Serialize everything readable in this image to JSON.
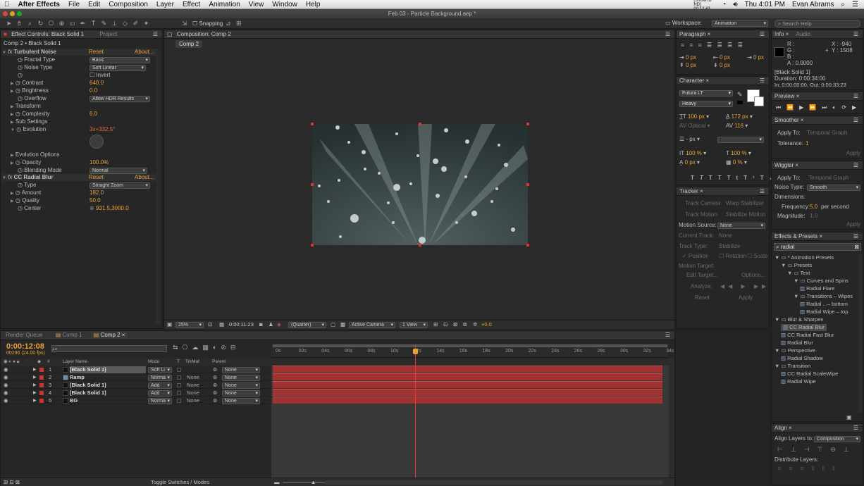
{
  "menubar": {
    "apple": "",
    "app": "After Effects",
    "items": [
      "File",
      "Edit",
      "Composition",
      "Layer",
      "Effect",
      "Animation",
      "View",
      "Window",
      "Help"
    ],
    "status_showhd": "[ShowHD HD] 00:12:43",
    "clock": "Thu 4:01 PM",
    "user": "Evan Abrams"
  },
  "window": {
    "title": "Feb 03 - Particle Background.aep *"
  },
  "toolbar": {
    "snapping": "Snapping",
    "workspace_label": "Workspace:",
    "workspace_value": "Animation",
    "search_placeholder": "Search Help"
  },
  "effect_controls": {
    "tab": "Effect Controls: Black Solid 1",
    "project_tab": "Project",
    "breadcrumb": "Comp 2 • Black Solid 1",
    "turbulent": {
      "name": "Turbulent Noise",
      "reset": "Reset",
      "about": "About...",
      "fractal_type_label": "Fractal Type",
      "fractal_type": "Basic",
      "noise_type_label": "Noise Type",
      "noise_type": "Soft Linear",
      "invert_label": "Invert",
      "contrast_label": "Contrast",
      "contrast": "640.0",
      "brightness_label": "Brightness",
      "brightness": "0.0",
      "overflow_label": "Overflow",
      "overflow": "Allow HDR Results",
      "transform_label": "Transform",
      "complexity_label": "Complexity",
      "complexity": "6.0",
      "sub_settings_label": "Sub Settings",
      "evolution_label": "Evolution",
      "evolution": "3x+332.5°",
      "evolution_options_label": "Evolution Options",
      "opacity_label": "Opacity",
      "opacity": "100.0%",
      "blending_label": "Blending Mode",
      "blending": "Normal"
    },
    "radial": {
      "name": "CC Radial Blur",
      "reset": "Reset",
      "about": "About...",
      "type_label": "Type",
      "type": "Straight Zoom",
      "amount_label": "Amount",
      "amount": "182.0",
      "quality_label": "Quality",
      "quality": "50.0",
      "center_label": "Center",
      "center": "931.5,3000.0"
    }
  },
  "composition": {
    "tab": "Composition: Comp 2",
    "subtab": "Comp 2",
    "zoom": "25%",
    "timecode": "0:00:11:23",
    "resolution": "(Quarter)",
    "camera": "Active Camera",
    "views": "1 View",
    "exposure": "+0.0",
    "bg_color": "#2f3b3b"
  },
  "paragraph": {
    "tab": "Paragraph",
    "v1": "0 px",
    "v2": "0 px",
    "v3": "0 px",
    "v4": "0 px",
    "v5": "0 px"
  },
  "character": {
    "tab": "Character",
    "font": "Futura LT",
    "style": "Heavy",
    "size": "100 px",
    "leading": "172 px",
    "kerning": "Optical",
    "tracking": "116",
    "stroke": "- px",
    "vscale": "100 %",
    "hscale": "100 %",
    "baseline": "0 px",
    "tsume": "0 %"
  },
  "tracker": {
    "tab": "Tracker",
    "track_camera": "Track Camera",
    "warp": "Warp Stabilizer",
    "track_motion": "Track Motion",
    "stabilize": "Stabilize Motion",
    "motion_source_label": "Motion Source:",
    "motion_source": "None",
    "current_track_label": "Current Track:",
    "current_track": "None",
    "track_type_label": "Track Type:",
    "track_type": "Stabilize",
    "position": "Position",
    "rotation": "Rotation",
    "scale": "Scale",
    "motion_target": "Motion Target:",
    "edit_target": "Edit Target...",
    "options": "Options...",
    "analyze": "Analyze:",
    "reset": "Reset",
    "apply": "Apply"
  },
  "info": {
    "tab": "Info",
    "audio_tab": "Audio",
    "r": "R :",
    "g": "G :",
    "b": "B :",
    "a": "A : 0.0000",
    "x": "X : -940",
    "y": "Y : 1508",
    "layer": "[Black Solid 1]",
    "duration": "Duration: 0:00:34:00",
    "inout": "In: 0:00:00:00, Out: 0:00:33:23"
  },
  "preview": {
    "tab": "Preview"
  },
  "smoother": {
    "tab": "Smoother",
    "apply_to_label": "Apply To:",
    "apply_to": "Temporal Graph",
    "tolerance_label": "Tolerance:",
    "tolerance": "1",
    "apply": "Apply"
  },
  "wiggler": {
    "tab": "Wiggler",
    "apply_to_label": "Apply To:",
    "apply_to": "Temporal Graph",
    "noise_label": "Noise Type:",
    "noise": "Smooth",
    "dimensions_label": "Dimensions:",
    "frequency_label": "Frequency:",
    "frequency": "5.0",
    "per_second": "per second",
    "magnitude_label": "Magnitude:",
    "magnitude": "1.0",
    "apply": "Apply"
  },
  "effects_presets": {
    "tab": "Effects & Presets",
    "search": "radial",
    "tree": [
      {
        "label": "* Animation Presets",
        "indent": 0,
        "type": "folder"
      },
      {
        "label": "Presets",
        "indent": 1,
        "type": "folder"
      },
      {
        "label": "Text",
        "indent": 2,
        "type": "folder"
      },
      {
        "label": "Curves and Spins",
        "indent": 3,
        "type": "folder"
      },
      {
        "label": "Radial Flare",
        "indent": 4,
        "type": "item"
      },
      {
        "label": "Transitions – Wipes",
        "indent": 3,
        "type": "folder"
      },
      {
        "label": "Radial ...– bottom",
        "indent": 4,
        "type": "item"
      },
      {
        "label": "Radial Wipe – top",
        "indent": 4,
        "type": "item"
      },
      {
        "label": "Blur & Sharpen",
        "indent": 0,
        "type": "folder"
      },
      {
        "label": "CC Radial Blur",
        "indent": 1,
        "type": "item",
        "selected": true
      },
      {
        "label": "CC Radial Fast Blur",
        "indent": 1,
        "type": "item"
      },
      {
        "label": "Radial Blur",
        "indent": 1,
        "type": "item"
      },
      {
        "label": "Perspective",
        "indent": 0,
        "type": "folder"
      },
      {
        "label": "Radial Shadow",
        "indent": 1,
        "type": "item"
      },
      {
        "label": "Transition",
        "indent": 0,
        "type": "folder"
      },
      {
        "label": "CC Radial ScaleWipe",
        "indent": 1,
        "type": "item"
      },
      {
        "label": "Radial Wipe",
        "indent": 1,
        "type": "item"
      }
    ]
  },
  "align": {
    "tab": "Align",
    "align_to_label": "Align Layers to:",
    "align_to": "Composition",
    "distribute": "Distribute Layers:"
  },
  "timeline": {
    "tabs": [
      "Render Queue",
      "Comp 1",
      "Comp 2"
    ],
    "timecode": "0:00:12:08",
    "frames": "00296 (24.00 fps)",
    "cols": {
      "num": "#",
      "name": "Layer Name",
      "mode": "Mode",
      "t": "T",
      "trkmat": "TrkMat",
      "parent": "Parent"
    },
    "ruler": [
      "0s",
      "02s",
      "04s",
      "06s",
      "08s",
      "10s",
      "12s",
      "14s",
      "16s",
      "18s",
      "20s",
      "22s",
      "24s",
      "26s",
      "28s",
      "30s",
      "32s",
      "34s"
    ],
    "layers": [
      {
        "num": "1",
        "name": "[Black Solid 1]",
        "mode": "Soft Li",
        "trkmat": "",
        "parent": "None",
        "selected": true
      },
      {
        "num": "2",
        "name": "Ramp",
        "mode": "Norma",
        "trkmat": "None",
        "parent": "None"
      },
      {
        "num": "3",
        "name": "[Black Solid 1]",
        "mode": "Add",
        "trkmat": "None",
        "parent": "None"
      },
      {
        "num": "4",
        "name": "[Black Solid 1]",
        "mode": "Add",
        "trkmat": "None",
        "parent": "None"
      },
      {
        "num": "5",
        "name": "BG",
        "mode": "Norma",
        "trkmat": "None",
        "parent": "None"
      }
    ],
    "toggle": "Toggle Switches / Modes"
  }
}
